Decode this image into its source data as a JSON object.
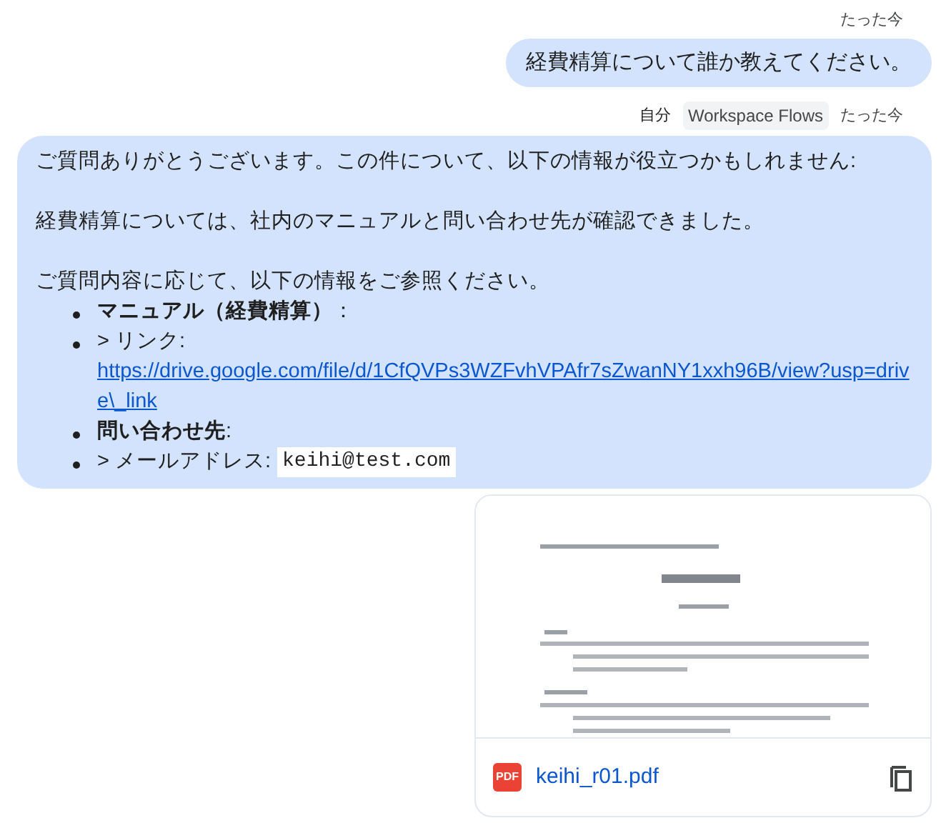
{
  "user_message": {
    "time": "たった今",
    "text": "経費精算について誰か教えてください。"
  },
  "reply": {
    "sender": "自分",
    "app": "Workspace Flows",
    "time": "たった今",
    "paragraphs": [
      "ご質問ありがとうございます。この件について、以下の情報が役立つかもしれません:",
      "経費精算については、社内のマニュアルと問い合わせ先が確認できました。",
      "ご質問内容に応じて、以下の情報をご参照ください。"
    ],
    "bullets": [
      {
        "kind": "text",
        "text": "**マニュアル（経費精算）**："
      },
      {
        "kind": "link",
        "label": "> リンク:",
        "url": "https://drive.google.com/file/d/1CfQVPs3WZFvhVPAfr7sZwanNY1xxh96B/view?usp=drive\\_link"
      },
      {
        "kind": "text",
        "text": "**問い合わせ先**:"
      },
      {
        "kind": "code",
        "label": "> メールアドレス:",
        "code": "keihi@test.com"
      }
    ]
  },
  "attachment": {
    "file_badge": "PDF",
    "file_name": "keihi_r01.pdf"
  }
}
